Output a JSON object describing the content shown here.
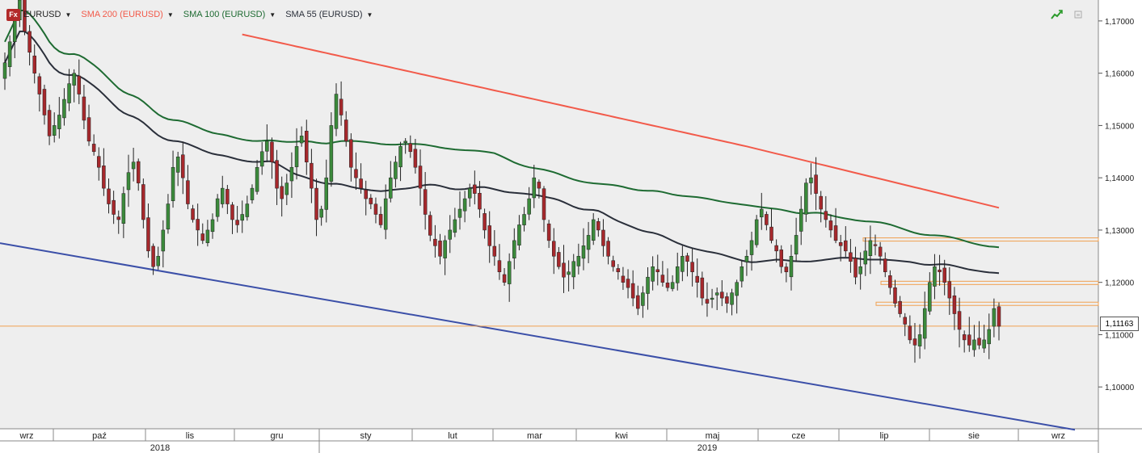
{
  "legend": {
    "symbol": "EURUSD",
    "logo": "Fx",
    "indicators": [
      {
        "label": "SMA 200 (EURUSD)",
        "color": "#f25a4a"
      },
      {
        "label": "SMA 100 (EURUSD)",
        "color": "#1e6b32"
      },
      {
        "label": "SMA 55 (EURUSD)",
        "color": "#2a2f3a"
      }
    ]
  },
  "icons": {
    "chart_toggle": "trend-chart-icon",
    "window": "restore-icon",
    "dropdown": "chevron-down-icon"
  },
  "current_price": "1,11163",
  "colors": {
    "background": "#eeeeee",
    "bull_candle": "#3b8a3b",
    "bear_candle": "#a6282c",
    "trendline": "#3b4fa8",
    "support_lines": "#f0a050"
  },
  "chart_data": {
    "type": "candlestick",
    "title": "EURUSD",
    "ylim": [
      1.092,
      1.174
    ],
    "y_ticks": [
      "1,10000",
      "1,11000",
      "1,12000",
      "1,13000",
      "1,14000",
      "1,15000",
      "1,16000",
      "1,17000"
    ],
    "y_tick_values": [
      1.1,
      1.11,
      1.12,
      1.13,
      1.14,
      1.15,
      1.16,
      1.17
    ],
    "x_months": [
      "wrz",
      "paź",
      "lis",
      "gru",
      "sty",
      "lut",
      "mar",
      "kwi",
      "maj",
      "cze",
      "lip",
      "sie",
      "wrz"
    ],
    "x_years": [
      "2018",
      "2019"
    ],
    "horizontal_levels": [
      1.1282,
      1.1199,
      1.1159,
      1.11163
    ],
    "closes": [
      1.162,
      1.166,
      1.17,
      1.174,
      1.168,
      1.164,
      1.16,
      1.156,
      1.152,
      1.148,
      1.15,
      1.152,
      1.155,
      1.158,
      1.16,
      1.156,
      1.151,
      1.147,
      1.145,
      1.142,
      1.138,
      1.135,
      1.133,
      1.132,
      1.137,
      1.141,
      1.143,
      1.139,
      1.132,
      1.126,
      1.123,
      1.125,
      1.13,
      1.135,
      1.142,
      1.144,
      1.14,
      1.135,
      1.132,
      1.13,
      1.128,
      1.13,
      1.132,
      1.136,
      1.138,
      1.135,
      1.132,
      1.131,
      1.133,
      1.135,
      1.138,
      1.142,
      1.145,
      1.147,
      1.143,
      1.138,
      1.136,
      1.139,
      1.142,
      1.146,
      1.148,
      1.143,
      1.138,
      1.132,
      1.134,
      1.14,
      1.15,
      1.156,
      1.152,
      1.147,
      1.142,
      1.14,
      1.138,
      1.136,
      1.135,
      1.133,
      1.131,
      1.136,
      1.14,
      1.143,
      1.146,
      1.147,
      1.145,
      1.142,
      1.138,
      1.133,
      1.129,
      1.127,
      1.125,
      1.128,
      1.13,
      1.132,
      1.134,
      1.136,
      1.138,
      1.137,
      1.134,
      1.13,
      1.127,
      1.125,
      1.122,
      1.12,
      1.124,
      1.128,
      1.131,
      1.133,
      1.136,
      1.14,
      1.138,
      1.132,
      1.128,
      1.125,
      1.123,
      1.121,
      1.122,
      1.124,
      1.125,
      1.127,
      1.129,
      1.132,
      1.13,
      1.127,
      1.125,
      1.123,
      1.122,
      1.12,
      1.119,
      1.117,
      1.115,
      1.118,
      1.121,
      1.123,
      1.122,
      1.12,
      1.119,
      1.12,
      1.123,
      1.125,
      1.124,
      1.122,
      1.12,
      1.117,
      1.116,
      1.117,
      1.118,
      1.117,
      1.116,
      1.118,
      1.12,
      1.123,
      1.125,
      1.128,
      1.132,
      1.134,
      1.131,
      1.128,
      1.126,
      1.123,
      1.122,
      1.125,
      1.129,
      1.134,
      1.139,
      1.14,
      1.137,
      1.134,
      1.132,
      1.13,
      1.128,
      1.127,
      1.126,
      1.124,
      1.121,
      1.123,
      1.126,
      1.128,
      1.127,
      1.125,
      1.122,
      1.119,
      1.116,
      1.114,
      1.112,
      1.109,
      1.108,
      1.11,
      1.115,
      1.12,
      1.123,
      1.122,
      1.12,
      1.117,
      1.114,
      1.111,
      1.109,
      1.108,
      1.109,
      1.108,
      1.109,
      1.111,
      1.115,
      1.1116
    ]
  }
}
